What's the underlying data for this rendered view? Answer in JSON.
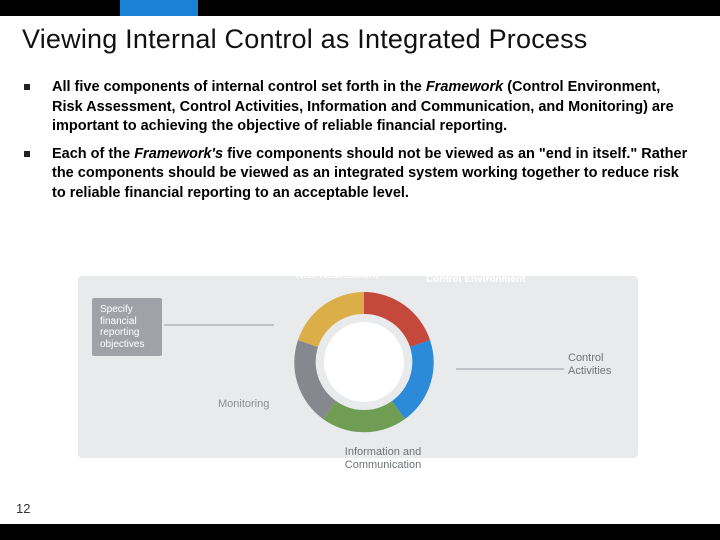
{
  "title": "Viewing Internal Control as Integrated Process",
  "bullets": [
    "All five components of internal control set forth in the <i>Framework</i> (Control Environment, Risk Assessment, Control Activities, Information and Communication, and Monitoring) are important to achieving the objective of reliable financial reporting.",
    "Each of the <i>Framework's</i> five components should not be viewed as an \"end in itself.\" Rather the components should be viewed as an integrated system working together to reduce risk to reliable financial reporting to an acceptable level."
  ],
  "diagram": {
    "left_label": "Specify financial reporting objectives",
    "segments": [
      {
        "name": "Risk Assessment",
        "color": "#c0392b"
      },
      {
        "name": "Control Environment",
        "color": "#1a82d6"
      },
      {
        "name": "Control Activities",
        "color": "#5a8f3a"
      },
      {
        "name": "Information and Communication",
        "color": "#7a7d82"
      },
      {
        "name": "Monitoring",
        "color": "#d9a83a"
      }
    ]
  },
  "page_number": "12"
}
